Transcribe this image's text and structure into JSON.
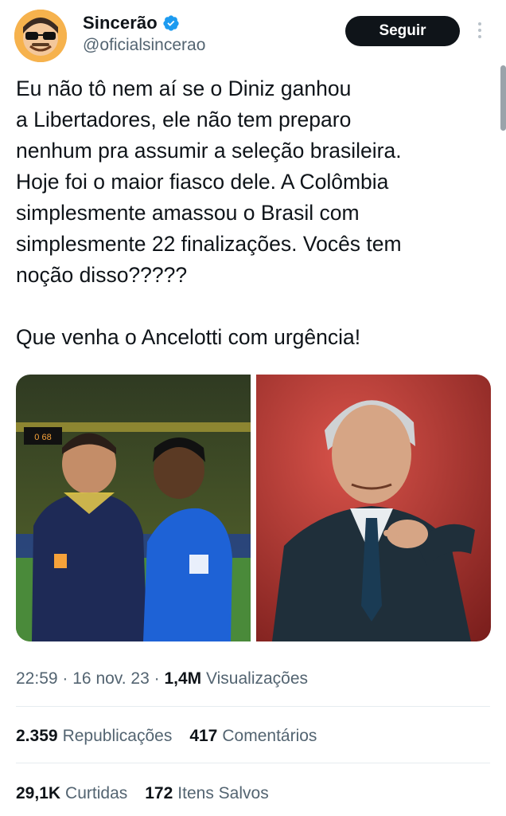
{
  "profile": {
    "display_name": "Sincerão",
    "handle": "@oficialsincerao",
    "follow_label": "Seguir"
  },
  "tweet": {
    "paragraph1": "Eu não tô nem aí se o Diniz ganhou\na Libertadores, ele não tem preparo\nnenhum pra assumir a seleção brasileira.\nHoje foi o maior fiasco dele. A Colômbia\nsimplesmente amassou o Brasil com\nsimplesmente 22 finalizações. Vocês tem\nnoção disso?????",
    "paragraph2": "Que venha o Ancelotti com urgência!"
  },
  "media": {
    "left_scoreboard": "0 68"
  },
  "meta": {
    "time": "22:59",
    "date": "16 nov. 23",
    "sep": "·",
    "views_count": "1,4M",
    "views_label": "Visualizações"
  },
  "stats": {
    "reposts_count": "2.359",
    "reposts_label": "Republicações",
    "quotes_count": "417",
    "quotes_label": "Comentários",
    "likes_count": "29,1K",
    "likes_label": "Curtidas",
    "bookmarks_count": "172",
    "bookmarks_label": "Itens Salvos"
  },
  "colors": {
    "verified": "#1d9bf0",
    "secondary_text": "#536471",
    "button_bg": "#0f1419"
  }
}
